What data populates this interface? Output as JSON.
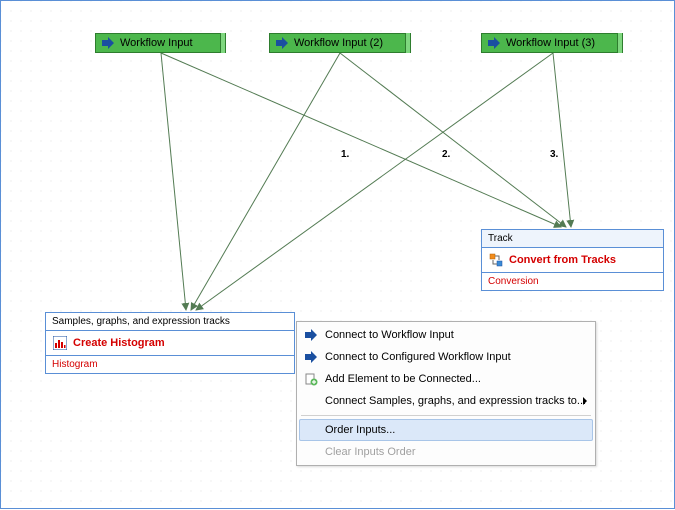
{
  "inputs": [
    {
      "label": "Workflow Input"
    },
    {
      "label": "Workflow Input (2)"
    },
    {
      "label": "Workflow Input (3)"
    }
  ],
  "histogram_node": {
    "header": "Samples, graphs, and expression tracks",
    "action": "Create Histogram",
    "output": "Histogram"
  },
  "convert_node": {
    "header": "Track",
    "action": "Convert from Tracks",
    "output": "Conversion"
  },
  "edge_labels": {
    "e1": "1.",
    "e2": "2.",
    "e3": "3."
  },
  "context_menu": {
    "connect_input": "Connect to Workflow Input",
    "connect_configured": "Connect to Configured Workflow Input",
    "add_element": "Add Element to be Connected...",
    "connect_samples": "Connect Samples, graphs, and expression tracks to...",
    "order_inputs": "Order Inputs...",
    "clear_order": "Clear Inputs Order"
  }
}
